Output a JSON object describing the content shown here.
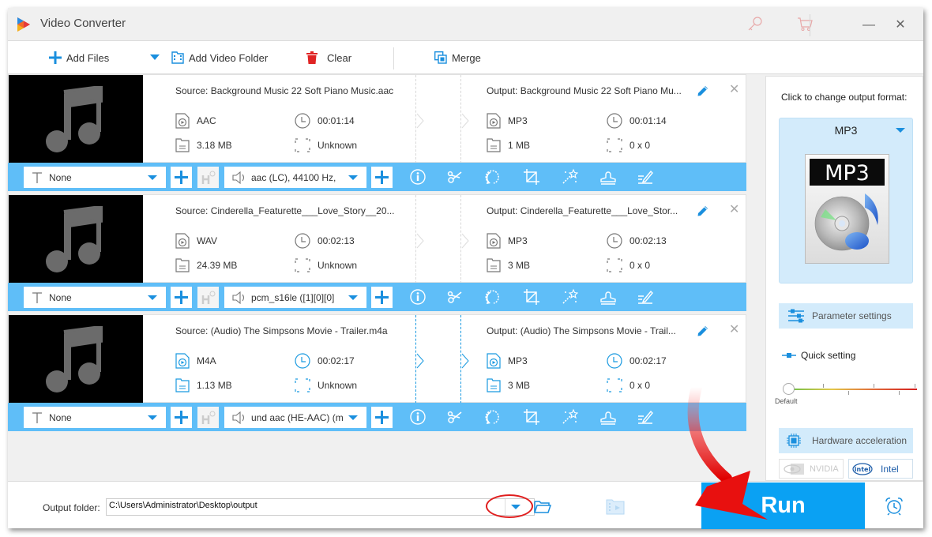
{
  "app": {
    "title": "Video Converter",
    "window_controls": {
      "minimize": "—",
      "close": "✕"
    }
  },
  "toolbar": {
    "add_files": "Add Files",
    "add_video_folder": "Add Video Folder",
    "clear": "Clear",
    "merge": "Merge"
  },
  "items": [
    {
      "source_title": "Source: Background Music 22 Soft Piano Music.aac",
      "source_format": "AAC",
      "source_duration": "00:01:14",
      "source_size": "3.18 MB",
      "source_resolution": "Unknown",
      "output_title": "Output: Background Music 22 Soft Piano Mu...",
      "output_format": "MP3",
      "output_duration": "00:01:14",
      "output_size": "1 MB",
      "output_resolution": "0 x 0",
      "subtitle": "None",
      "audio_track": "aac (LC), 44100 Hz,",
      "selected": false
    },
    {
      "source_title": "Source: Cinderella_Featurette___Love_Story__20...",
      "source_format": "WAV",
      "source_duration": "00:02:13",
      "source_size": "24.39 MB",
      "source_resolution": "Unknown",
      "output_title": "Output: Cinderella_Featurette___Love_Stor...",
      "output_format": "MP3",
      "output_duration": "00:02:13",
      "output_size": "3 MB",
      "output_resolution": "0 x 0",
      "subtitle": "None",
      "audio_track": "pcm_s16le ([1][0][0]",
      "selected": false
    },
    {
      "source_title": "Source: (Audio) The Simpsons Movie - Trailer.m4a",
      "source_format": "M4A",
      "source_duration": "00:02:17",
      "source_size": "1.13 MB",
      "source_resolution": "Unknown",
      "output_title": "Output: (Audio) The Simpsons Movie - Trail...",
      "output_format": "MP3",
      "output_duration": "00:02:17",
      "output_size": "3 MB",
      "output_resolution": "0 x 0",
      "subtitle": "None",
      "audio_track": "und aac (HE-AAC) (m",
      "selected": true
    }
  ],
  "item_tools": [
    "info-icon",
    "scissors-icon",
    "rotate-icon",
    "crop-icon",
    "effects-wand-icon",
    "watermark-stamp-icon",
    "edit-subtitle-icon"
  ],
  "panel": {
    "label": "Click to change output format:",
    "format": "MP3",
    "format_image_text": "MP3",
    "parameter_settings": "Parameter settings",
    "quick_setting": "Quick setting",
    "quality_level": 0,
    "quality_label": "Default",
    "hardware_acceleration": "Hardware acceleration",
    "gpu_nvidia": "NVIDIA",
    "gpu_intel": "Intel",
    "intel_logo_text": "intel"
  },
  "bottom": {
    "output_folder_label": "Output folder:",
    "output_folder_value": "C:\\Users\\Administrator\\Desktop\\output",
    "run": "Run"
  },
  "colors": {
    "accent": "#1a9ae0",
    "strip": "#5fbef8",
    "run": "#0aa1f3",
    "annotation": "#e01e1e"
  }
}
